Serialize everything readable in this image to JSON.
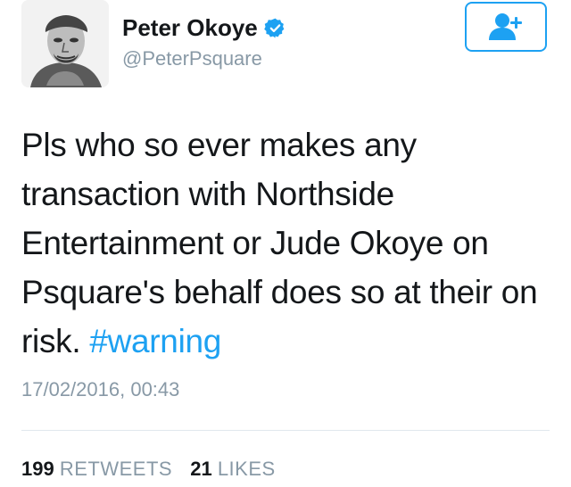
{
  "author": {
    "name": "Peter Okoye",
    "handle": "@PeterPsquare",
    "verified_icon": "verified-badge-icon",
    "avatar_desc": "avatar"
  },
  "follow_button": {
    "icon": "add-user-icon"
  },
  "tweet": {
    "text": "Pls who so ever makes any transaction with Northside Entertainment or Jude Okoye on Psquare's behalf does so at their on risk. ",
    "hashtag": "#warning",
    "timestamp": "17/02/2016, 00:43"
  },
  "stats": {
    "retweets_count": "199",
    "retweets_label": "RETWEETS",
    "likes_count": "21",
    "likes_label": "LIKES"
  },
  "colors": {
    "accent": "#1da1f2",
    "muted": "#8899a6",
    "text": "#14171a",
    "divider": "#e1e8ed"
  }
}
